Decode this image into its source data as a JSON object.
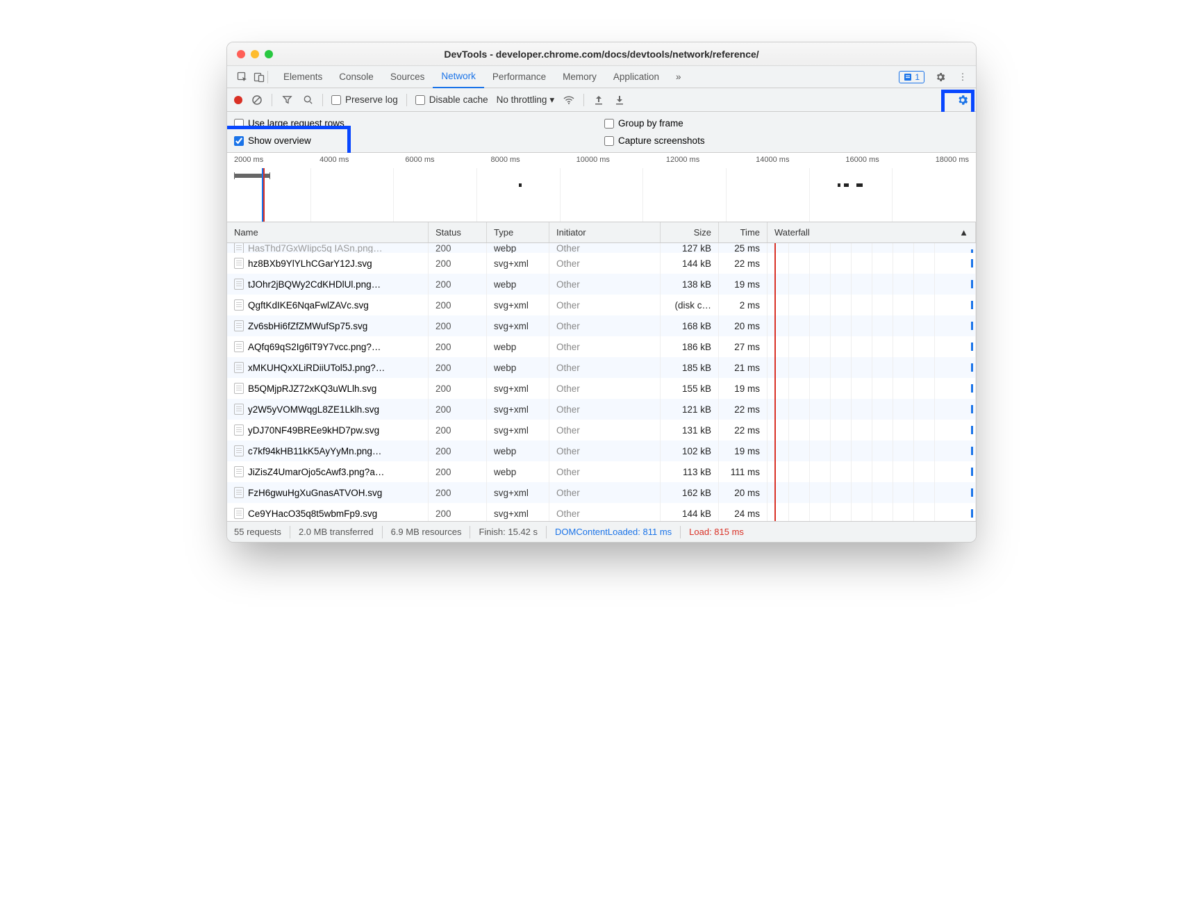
{
  "title": "DevTools - developer.chrome.com/docs/devtools/network/reference/",
  "tabs": [
    "Elements",
    "Console",
    "Sources",
    "Network",
    "Performance",
    "Memory",
    "Application"
  ],
  "active_tab": "Network",
  "issues_count": "1",
  "toolbar": {
    "preserve_log": "Preserve log",
    "disable_cache": "Disable cache",
    "throttling": "No throttling"
  },
  "options": {
    "large_rows": "Use large request rows",
    "group_frame": "Group by frame",
    "show_overview": "Show overview",
    "capture_ss": "Capture screenshots"
  },
  "timeline_ticks": [
    "2000 ms",
    "4000 ms",
    "6000 ms",
    "8000 ms",
    "10000 ms",
    "12000 ms",
    "14000 ms",
    "16000 ms",
    "18000 ms"
  ],
  "columns": {
    "name": "Name",
    "status": "Status",
    "type": "Type",
    "initiator": "Initiator",
    "size": "Size",
    "time": "Time",
    "waterfall": "Waterfall"
  },
  "rows": [
    {
      "name": "HasThd7GxWIipc5q IASn.png…",
      "status": "200",
      "type": "webp",
      "initiator": "Other",
      "size": "127 kB",
      "time": "25 ms",
      "cut": true
    },
    {
      "name": "hz8BXb9YlYLhCGarY12J.svg",
      "status": "200",
      "type": "svg+xml",
      "initiator": "Other",
      "size": "144 kB",
      "time": "22 ms"
    },
    {
      "name": "tJOhr2jBQWy2CdKHDlUl.png…",
      "status": "200",
      "type": "webp",
      "initiator": "Other",
      "size": "138 kB",
      "time": "19 ms"
    },
    {
      "name": "QgftKdIKE6NqaFwlZAVc.svg",
      "status": "200",
      "type": "svg+xml",
      "initiator": "Other",
      "size": "(disk c…",
      "time": "2 ms"
    },
    {
      "name": "Zv6sbHi6fZfZMWufSp75.svg",
      "status": "200",
      "type": "svg+xml",
      "initiator": "Other",
      "size": "168 kB",
      "time": "20 ms"
    },
    {
      "name": "AQfq69qS2Ig6lT9Y7vcc.png?…",
      "status": "200",
      "type": "webp",
      "initiator": "Other",
      "size": "186 kB",
      "time": "27 ms"
    },
    {
      "name": "xMKUHQxXLiRDiiUTol5J.png?…",
      "status": "200",
      "type": "webp",
      "initiator": "Other",
      "size": "185 kB",
      "time": "21 ms"
    },
    {
      "name": "B5QMjpRJZ72xKQ3uWLlh.svg",
      "status": "200",
      "type": "svg+xml",
      "initiator": "Other",
      "size": "155 kB",
      "time": "19 ms"
    },
    {
      "name": "y2W5yVOMWqgL8ZE1Lklh.svg",
      "status": "200",
      "type": "svg+xml",
      "initiator": "Other",
      "size": "121 kB",
      "time": "22 ms"
    },
    {
      "name": "yDJ70NF49BREe9kHD7pw.svg",
      "status": "200",
      "type": "svg+xml",
      "initiator": "Other",
      "size": "131 kB",
      "time": "22 ms"
    },
    {
      "name": "c7kf94kHB11kK5AyYyMn.png…",
      "status": "200",
      "type": "webp",
      "initiator": "Other",
      "size": "102 kB",
      "time": "19 ms"
    },
    {
      "name": "JiZisZ4UmarOjo5cAwf3.png?a…",
      "status": "200",
      "type": "webp",
      "initiator": "Other",
      "size": "113 kB",
      "time": "111 ms"
    },
    {
      "name": "FzH6gwuHgXuGnasATVOH.svg",
      "status": "200",
      "type": "svg+xml",
      "initiator": "Other",
      "size": "162 kB",
      "time": "20 ms"
    },
    {
      "name": "Ce9YHacO35q8t5wbmFp9.svg",
      "status": "200",
      "type": "svg+xml",
      "initiator": "Other",
      "size": "144 kB",
      "time": "24 ms"
    }
  ],
  "status": {
    "requests": "55 requests",
    "transferred": "2.0 MB transferred",
    "resources": "6.9 MB resources",
    "finish": "Finish: 15.42 s",
    "dcl": "DOMContentLoaded: 811 ms",
    "load": "Load: 815 ms"
  }
}
